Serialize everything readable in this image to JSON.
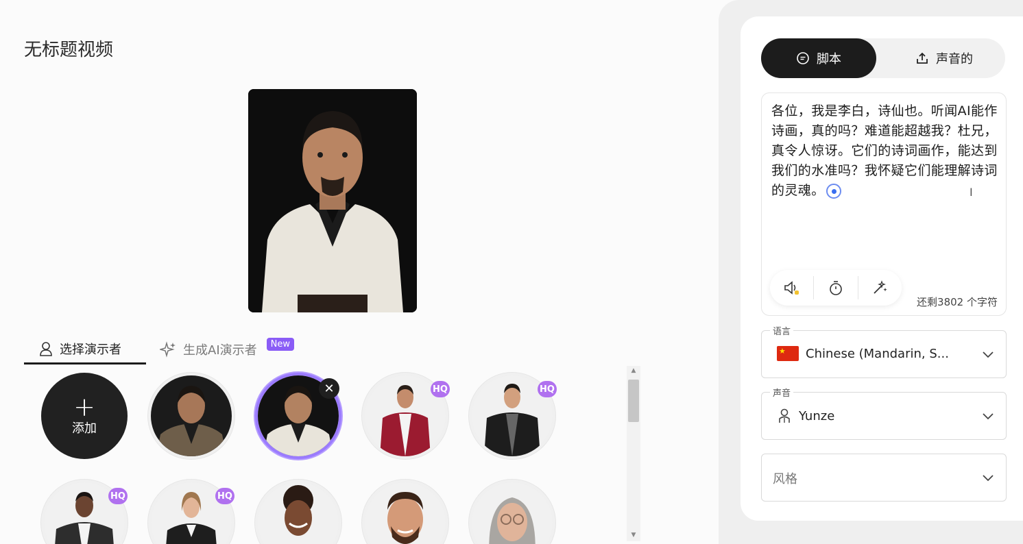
{
  "page": {
    "title": "无标题视频"
  },
  "tabs": {
    "presenter": "选择演示者",
    "ai": "生成AI演示者",
    "new_badge": "New"
  },
  "grid": {
    "add_label": "添加",
    "hq_label": "HQ",
    "avatars": [
      {
        "name": "presenter-li-bai-robe-dark",
        "hq": false
      },
      {
        "name": "presenter-li-bai-white-robe",
        "hq": false,
        "selected": true
      },
      {
        "name": "presenter-man-red-blazer",
        "hq": true
      },
      {
        "name": "presenter-man-black-jacket",
        "hq": true
      },
      {
        "name": "presenter-man-black-suit",
        "hq": true
      },
      {
        "name": "presenter-woman-blazer",
        "hq": true
      },
      {
        "name": "presenter-woman-curly-hair",
        "hq": false
      },
      {
        "name": "presenter-man-beard",
        "hq": false
      },
      {
        "name": "presenter-woman-gray-hair",
        "hq": false
      }
    ]
  },
  "panel": {
    "seg": {
      "script": "脚本",
      "audio": "声音的"
    },
    "script": {
      "text": "各位，我是李白，诗仙也。听闻AI能作诗画，真的吗？难道能超越我？杜兄，真令人惊讶。它们的诗词画作，能达到我们的水准吗？我怀疑它们能理解诗词的灵魂。",
      "chars_left": "还剩3802 个字符"
    },
    "language": {
      "label": "语言",
      "value": "Chinese (Mandarin, S..."
    },
    "voice": {
      "label": "声音",
      "value": "Yunze"
    },
    "style": {
      "placeholder": "风格"
    }
  },
  "colors": {
    "accent": "#8a5cf6",
    "hq": "#b071ef",
    "dark": "#1c1c1c"
  }
}
